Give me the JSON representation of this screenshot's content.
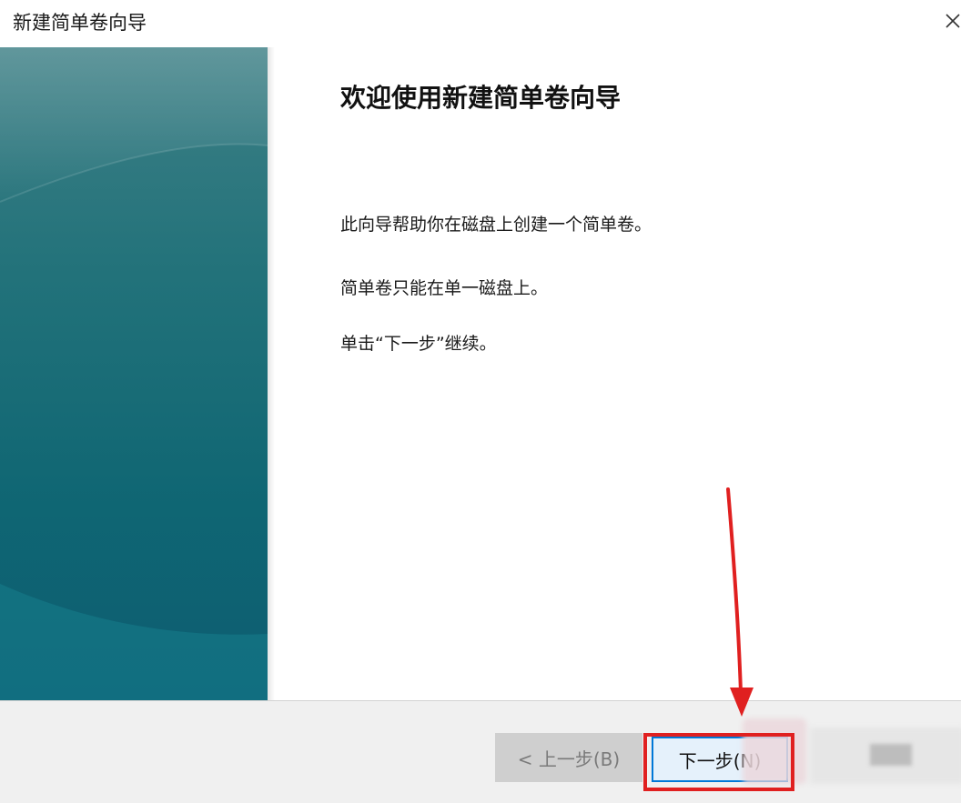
{
  "window": {
    "title": "新建简单卷向导",
    "close_glyph": "✕"
  },
  "content": {
    "heading": "欢迎使用新建简单卷向导",
    "line1": "此向导帮助你在磁盘上创建一个简单卷。",
    "line2": "简单卷只能在单一磁盘上。",
    "line3": "单击“下一步”继续。"
  },
  "footer": {
    "back_label": "< 上一步(B)",
    "next_label": "下一步(N)"
  },
  "annotation": {
    "color": "#e02020"
  },
  "colors": {
    "side_panel_top": "#3e8086",
    "side_panel_bottom": "#0d5d72",
    "accent_blue": "#0078d7"
  },
  "icons": {
    "close": "close-icon"
  }
}
